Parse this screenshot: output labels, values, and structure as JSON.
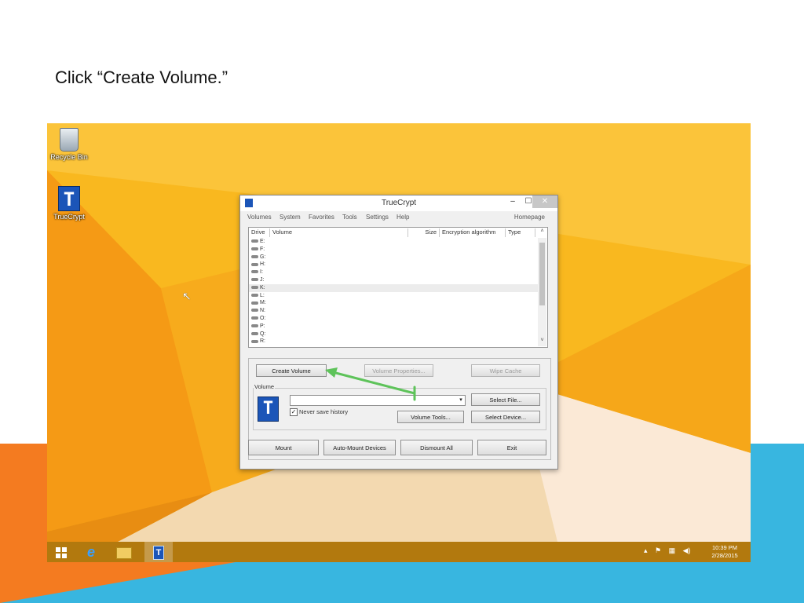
{
  "slide": {
    "instruction": "Click “Create Volume.”"
  },
  "desktop": {
    "icons": [
      {
        "label": "Recycle Bin",
        "icon": "recycle-bin-icon"
      },
      {
        "label": "TrueCrypt",
        "icon": "truecrypt-icon",
        "glyph": "T"
      }
    ],
    "cursor_glyph": "↖"
  },
  "window": {
    "title": "TrueCrypt",
    "controls": {
      "minimize": "–",
      "maximize": "☐",
      "close": "✕"
    },
    "menu": [
      "Volumes",
      "System",
      "Favorites",
      "Tools",
      "Settings",
      "Help"
    ],
    "homepage": "Homepage",
    "columns": [
      "Drive",
      "Volume",
      "Size",
      "Encryption algorithm",
      "Type"
    ],
    "drives": [
      "E:",
      "F:",
      "G:",
      "H:",
      "I:",
      "J:",
      "K:",
      "L:",
      "M:",
      "N:",
      "O:",
      "P:",
      "Q:",
      "R:"
    ],
    "selected_drive": "K:",
    "scroll": {
      "up": "˄",
      "down": "˅"
    },
    "buttons": {
      "create_volume": "Create Volume",
      "volume_properties": "Volume Properties...",
      "wipe_cache": "Wipe Cache",
      "select_file": "Select File...",
      "volume_tools": "Volume Tools...",
      "select_device": "Select Device...",
      "mount": "Mount",
      "auto_mount": "Auto-Mount Devices",
      "dismount_all": "Dismount All",
      "exit": "Exit"
    },
    "volume_group_label": "Volume",
    "volume_path": "",
    "combo_arrow": "▾",
    "logo_glyph": "T",
    "never_save_history": {
      "label": "Never save history",
      "checked": true,
      "mark": "✓"
    }
  },
  "taskbar": {
    "items": [
      {
        "name": "start",
        "icon": "windows-start-icon"
      },
      {
        "name": "internet-explorer",
        "icon": "internet-explorer-icon",
        "glyph": "e"
      },
      {
        "name": "file-explorer",
        "icon": "folder-icon"
      },
      {
        "name": "truecrypt",
        "icon": "truecrypt-icon",
        "glyph": "T",
        "active": true
      }
    ],
    "tray_glyphs": {
      "chevron": "▴",
      "flag": "⚑",
      "network": "▦",
      "volume": "◀)"
    },
    "clock": {
      "time": "10:39 PM",
      "date": "2/28/2015"
    }
  },
  "colors": {
    "wallpaper": "#f7b31e",
    "accent_orange": "#f47b20",
    "accent_blue": "#38b6e0",
    "annotation_arrow": "#5ec35a",
    "truecrypt_blue": "#1b55b8"
  }
}
